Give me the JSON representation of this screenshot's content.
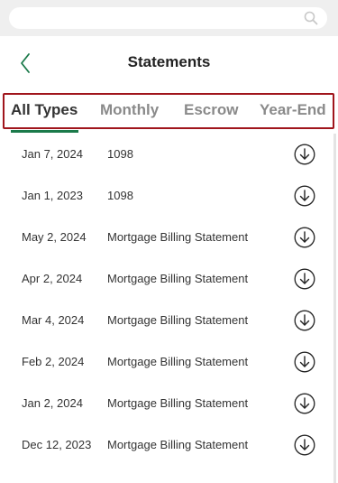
{
  "header": {
    "title": "Statements"
  },
  "icons": {
    "search": "search-icon",
    "back": "chevron-left-icon",
    "download": "download-icon"
  },
  "colors": {
    "accent_green": "#1b7a4a",
    "highlight_red": "#a0151c"
  },
  "tabs": [
    {
      "label": "All Types",
      "active": true
    },
    {
      "label": "Monthly",
      "active": false
    },
    {
      "label": "Escrow",
      "active": false
    },
    {
      "label": "Year-End",
      "active": false
    }
  ],
  "statements": [
    {
      "date": "Jan 7, 2024",
      "type": "1098"
    },
    {
      "date": "Jan 1, 2023",
      "type": "1098"
    },
    {
      "date": "May 2, 2024",
      "type": "Mortgage Billing Statement"
    },
    {
      "date": "Apr 2, 2024",
      "type": "Mortgage Billing Statement"
    },
    {
      "date": "Mar 4, 2024",
      "type": "Mortgage Billing Statement"
    },
    {
      "date": "Feb 2, 2024",
      "type": "Mortgage Billing Statement"
    },
    {
      "date": "Jan 2, 2024",
      "type": "Mortgage Billing Statement"
    },
    {
      "date": "Dec 12, 2023",
      "type": "Mortgage Billing Statement"
    }
  ]
}
